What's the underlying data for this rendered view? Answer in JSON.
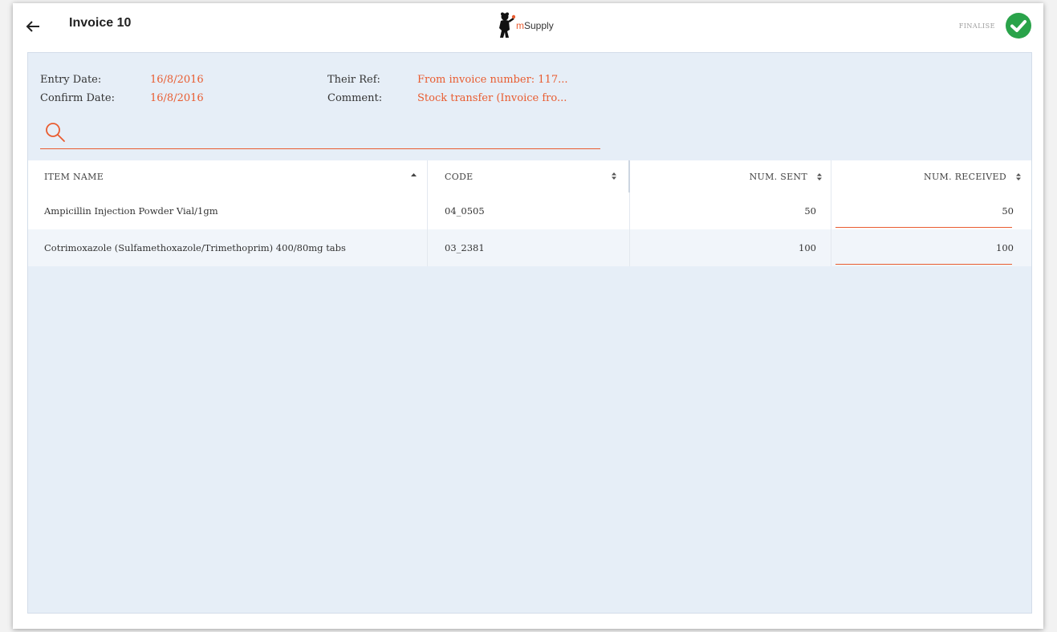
{
  "header": {
    "title": "Invoice 10",
    "logo": {
      "prefix": "m",
      "suffix": "Supply"
    },
    "finalise_label": "FINALISE"
  },
  "info": {
    "entry_date_label": "Entry Date:",
    "entry_date_value": "16/8/2016",
    "confirm_date_label": "Confirm Date:",
    "confirm_date_value": "16/8/2016",
    "their_ref_label": "Their Ref:",
    "their_ref_value": "From invoice number: 117...",
    "comment_label": "Comment:",
    "comment_value": "Stock transfer (Invoice fro..."
  },
  "search": {
    "placeholder": "",
    "value": ""
  },
  "table": {
    "columns": [
      "ITEM NAME",
      "CODE",
      "NUM. SENT",
      "NUM. RECEIVED"
    ],
    "rows": [
      {
        "item_name": "Ampicillin Injection Powder Vial/1gm",
        "code": "04_0505",
        "num_sent": "50",
        "num_received": "50"
      },
      {
        "item_name": "Cotrimoxazole (Sulfamethoxazole/Trimethoprim) 400/80mg tabs",
        "code": "03_2381",
        "num_sent": "100",
        "num_received": "100"
      }
    ]
  },
  "colors": {
    "accent": "#e95c30",
    "finalise_check": "#2aa34a",
    "panel_background": "#e6eef7"
  }
}
